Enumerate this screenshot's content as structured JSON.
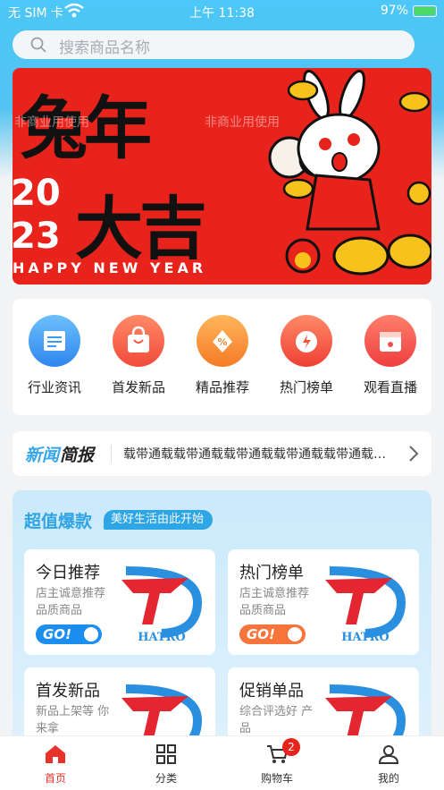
{
  "status_bar": {
    "carrier": "无 SIM 卡",
    "time": "上午 11:38",
    "battery": "97%"
  },
  "search": {
    "placeholder": "搜索商品名称"
  },
  "banner": {
    "line1": "兔年",
    "line2": "大吉",
    "year_top": "20",
    "year_bottom": "23",
    "subtitle": "HAPPY NEW YEAR",
    "watermark": "非商业用使用"
  },
  "categories": [
    {
      "label": "行业资讯",
      "icon": "news-doc-icon",
      "color": "#3c9bf2"
    },
    {
      "label": "首发新品",
      "icon": "shopping-bag-icon",
      "color": "#f7553f"
    },
    {
      "label": "精品推荐",
      "icon": "discount-tag-icon",
      "color": "#f68a2c"
    },
    {
      "label": "热门榜单",
      "icon": "alarm-flash-icon",
      "color": "#f2553b"
    },
    {
      "label": "观看直播",
      "icon": "calendar-live-icon",
      "color": "#f25050"
    }
  ],
  "news": {
    "title_part1": "新闻",
    "title_part2": "简报",
    "text": "载带通载载带通载载带通载载带通载载带通载载带通载"
  },
  "deals": {
    "title": "超值爆款",
    "tag": "美好生活由此开始",
    "cards": [
      {
        "title": "今日推荐",
        "desc": "店主诚意推荐品质商品",
        "go": "GO!",
        "go_color": "#1c8ef0",
        "brand": "HATRO"
      },
      {
        "title": "热门榜单",
        "desc": "店主诚意推荐品质商品",
        "go": "GO!",
        "go_color": "#f7743a",
        "brand": "HATRO"
      },
      {
        "title": "首发新品",
        "desc": "新品上架等 你来拿"
      },
      {
        "title": "促销单品",
        "desc": "综合评选好 产品"
      }
    ]
  },
  "tabbar": {
    "home": "首页",
    "category": "分类",
    "cart": "购物车",
    "cart_badge": "2",
    "mine": "我的"
  },
  "colors": {
    "accent": "#2fa3e3",
    "active_tab": "#e8332a",
    "banner_red": "#e8231b"
  }
}
